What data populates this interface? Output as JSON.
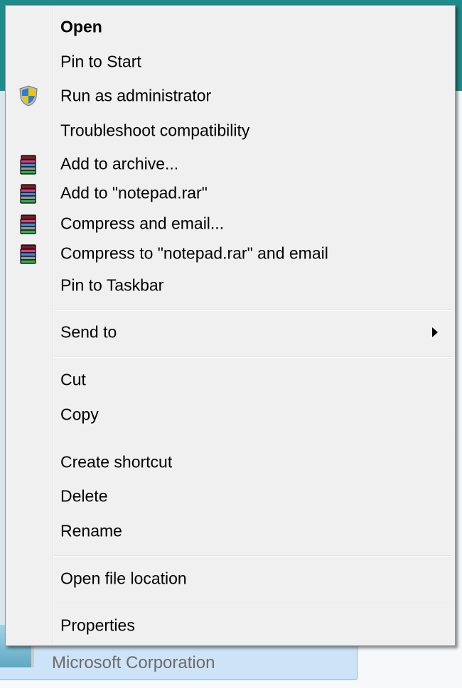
{
  "background": {
    "publisher": "Microsoft Corporation"
  },
  "menu": {
    "items": [
      {
        "label": "Open",
        "icon": null
      },
      {
        "label": "Pin to Start",
        "icon": null
      },
      {
        "label": "Run as administrator",
        "icon": "uac-shield-icon"
      },
      {
        "label": "Troubleshoot compatibility",
        "icon": null
      },
      {
        "label": "Add to archive...",
        "icon": "winrar-icon"
      },
      {
        "label": "Add to \"notepad.rar\"",
        "icon": "winrar-icon"
      },
      {
        "label": "Compress and email...",
        "icon": "winrar-icon"
      },
      {
        "label": "Compress to \"notepad.rar\" and email",
        "icon": "winrar-icon"
      },
      {
        "label": "Pin to Taskbar",
        "icon": null
      },
      {
        "label": "Send to",
        "icon": null,
        "submenu": true
      },
      {
        "label": "Cut",
        "icon": null
      },
      {
        "label": "Copy",
        "icon": null
      },
      {
        "label": "Create shortcut",
        "icon": null
      },
      {
        "label": "Delete",
        "icon": null
      },
      {
        "label": "Rename",
        "icon": null
      },
      {
        "label": "Open file location",
        "icon": null
      },
      {
        "label": "Properties",
        "icon": null
      }
    ]
  }
}
